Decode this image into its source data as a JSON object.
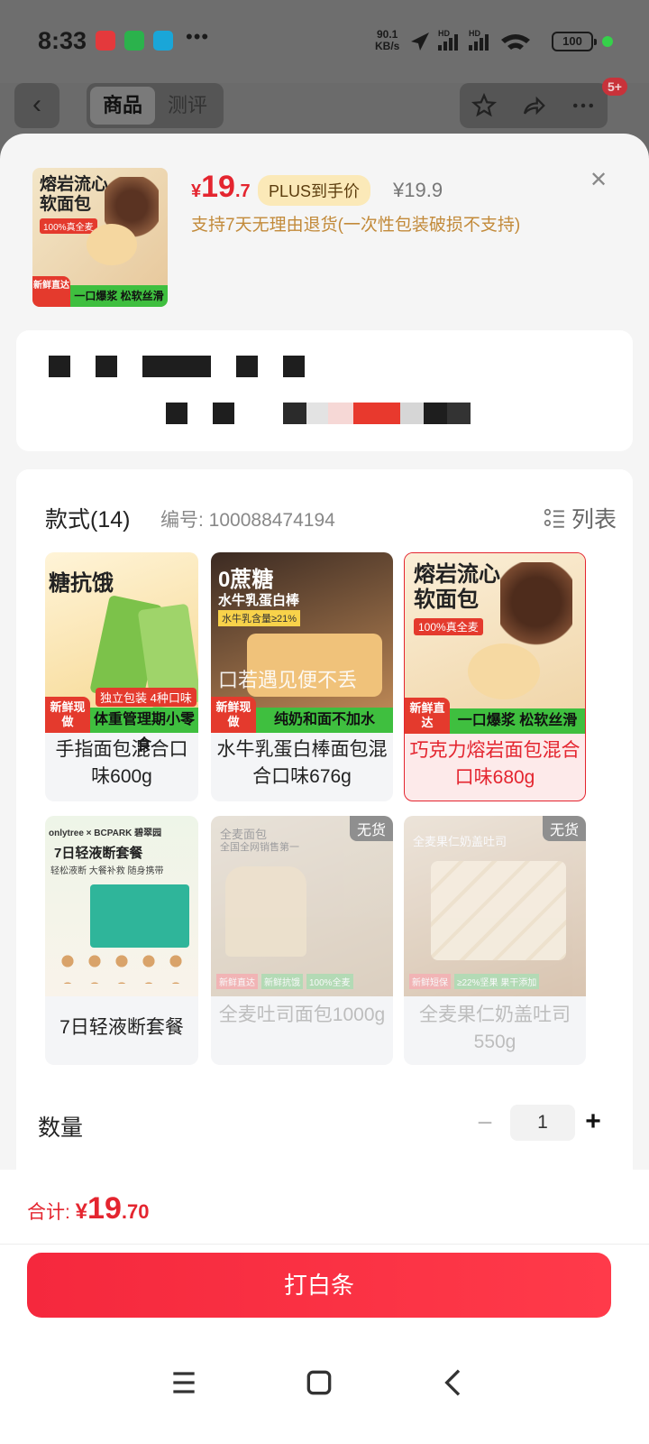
{
  "status": {
    "time": "8:33",
    "speed_top": "90.1",
    "speed_bottom": "KB/s",
    "network_labels": [
      "HD",
      "HD"
    ],
    "battery": "100"
  },
  "nav": {
    "tabs": [
      {
        "label": "商品",
        "active": true
      },
      {
        "label": "测评",
        "active": false
      }
    ],
    "badge": "5+"
  },
  "product": {
    "thumb_title": "熔岩流心\n软面包",
    "thumb_tag": "100%真全麦",
    "thumb_strip": "一口爆浆 松软丝滑",
    "thumb_fresh": "新鲜直达",
    "price_currency": "¥",
    "price_int": "19",
    "price_dec": ".7",
    "plus_label": "PLUS到手价",
    "original_price": "¥19.9",
    "return_note": "支持7天无理由退货(一次性包装破损不支持)"
  },
  "variants": {
    "title": "款式(14)",
    "code": "编号: 100088474194",
    "list_label": "列表",
    "items": [
      {
        "name": "手指面包混合口味600g",
        "img_title": "糖抗饿",
        "img_strip": "体重管理期小零食",
        "img_pill": "新鲜现做",
        "img_mid": "独立包装 4种口味",
        "status": "normal"
      },
      {
        "name": "水牛乳蛋白棒面包混合口味676g",
        "img_title": "0蔗糖",
        "img_sub": "水牛乳蛋白棒",
        "img_tag": "水牛乳含量≥21%",
        "img_strip": "纯奶和面不加水",
        "img_pill": "新鲜现做",
        "img_overlay": "口若遇见便不丢",
        "status": "normal"
      },
      {
        "name": "巧克力熔岩面包混合口味680g",
        "img_title": "熔岩流心\n软面包",
        "img_tag": "100%真全麦",
        "img_strip": "一口爆浆 松软丝滑",
        "img_pill": "新鲜直达",
        "status": "selected"
      },
      {
        "name": "7日轻液断套餐",
        "img_title": "7日轻液断套餐",
        "img_sub": "轻松液断 大餐补救 随身携带",
        "img_brand": "onlytree × BCPARK 碧翠园",
        "status": "normal"
      },
      {
        "name": "全麦吐司面包1000g",
        "img_title": "全麦面包",
        "img_sub": "全国全网销售第一",
        "img_tags": [
          "新鲜直达",
          "新鲜抗饿",
          "100%全麦"
        ],
        "badge": "无货",
        "status": "out_of_stock"
      },
      {
        "name": "全麦果仁奶盖吐司550g",
        "img_title": "全麦果仁奶盖吐司",
        "img_tags": [
          "新鲜短保",
          "≥22%坚果 果干添加"
        ],
        "badge": "无货",
        "status": "out_of_stock"
      }
    ]
  },
  "quantity": {
    "label": "数量",
    "value": "1",
    "minus": "−",
    "plus": "+"
  },
  "footer": {
    "total_label": "合计: ",
    "currency": "¥",
    "total_int": "19",
    "total_dec": ".70",
    "cta_label": "打白条"
  },
  "colors": {
    "accent_red": "#e4252f",
    "plus_bg": "#fbe9b8",
    "note_gold": "#c28a3a",
    "strip_green": "#3fbf3f"
  }
}
